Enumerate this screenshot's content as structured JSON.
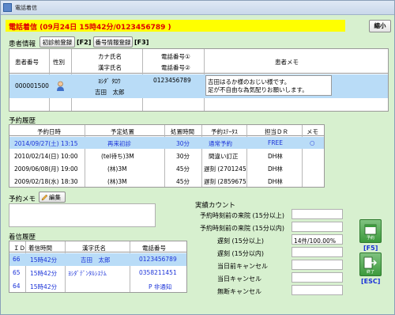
{
  "window": {
    "title": "電話着信",
    "minimize_label": "縮小"
  },
  "banner": "電話着信 (09月24日 15時42分/0123456789 )",
  "patient_section": {
    "title": "患者情報",
    "first_visit_btn": "初診前登録",
    "first_visit_key": "[F2]",
    "number_info_btn": "番号情報登録",
    "number_info_key": "[F3]",
    "headers": {
      "id": "患者番号",
      "sex": "性別",
      "kana": "カナ氏名",
      "kanji": "漢字氏名",
      "tel1": "電話番号①",
      "tel2": "電話番号②",
      "memo": "患者メモ"
    },
    "row": {
      "id": "000001500",
      "kana": "ﾖｼﾀﾞ ﾀﾛｳ",
      "kanji": "吉田　太郎",
      "tel1": "0123456789",
      "memo_line1": "吉田はるか様のおじい様です。",
      "memo_line2": "足が不自由な為気配りお願いします。"
    }
  },
  "reservation_section": {
    "title": "予約履歴",
    "headers": [
      "予約日時",
      "予定処置",
      "処置時間",
      "予約ｽﾃｰﾀｽ",
      "担当ＤＲ",
      "メモ"
    ],
    "rows": [
      {
        "date": "2014/09/27(土) 13:15",
        "treatment": "再来初診",
        "time": "30分",
        "status": "通常予約",
        "dr": "FREE",
        "memo": "○",
        "highlight": true
      },
      {
        "date": "2010/02/14(日) 10:00",
        "treatment": "(tel待ち)3M",
        "time": "30分",
        "status": "間違い訂正",
        "dr": "DH林",
        "memo": "",
        "highlight": false
      },
      {
        "date": "2009/06/08(月) 19:00",
        "treatment": "(林)3M",
        "time": "45分",
        "status": "遅刻 (2701245",
        "dr": "DH林",
        "memo": "",
        "highlight": false
      },
      {
        "date": "2009/02/18(水) 18:30",
        "treatment": "(林)3M",
        "time": "45分",
        "status": "遅刻 (2859675",
        "dr": "DH林",
        "memo": "",
        "highlight": false
      }
    ]
  },
  "reservation_memo": {
    "title": "予約メモ",
    "edit_btn": "編集"
  },
  "count_section": {
    "title": "実績カウント",
    "rows": [
      {
        "label": "予約時刻前の来院 (15分以上)",
        "value": ""
      },
      {
        "label": "予約時刻前の来院 (15分以内)",
        "value": ""
      },
      {
        "label": "遅刻 (15分以上)",
        "value": "14件/100.00%"
      },
      {
        "label": "遅刻 (15分以内)",
        "value": ""
      },
      {
        "label": "当日前キャンセル",
        "value": ""
      },
      {
        "label": "当日キャンセル",
        "value": ""
      },
      {
        "label": "無断キャンセル",
        "value": ""
      }
    ]
  },
  "call_history": {
    "title": "着信履歴",
    "headers": [
      "ＩＤ",
      "着信時間",
      "漢字氏名",
      "電話番号"
    ],
    "rows": [
      {
        "id": "66",
        "time": "15時42分",
        "name": "吉田　太郎",
        "tel": "0123456789",
        "highlight": true
      },
      {
        "id": "65",
        "time": "15時42分",
        "name": "ﾖｼﾀﾞﾃﾞﾝﾀﾙｼｽﾃﾑ",
        "tel": "0358211451",
        "highlight": false
      },
      {
        "id": "64",
        "time": "15時42分",
        "name": "",
        "tel": "P 非通知",
        "highlight": false
      }
    ]
  },
  "side_buttons": {
    "reserve_key": "[F5]",
    "close_key": "[ESC]",
    "reserve_label": "予約",
    "close_label": "終了"
  },
  "colors": {
    "accent_blue": "#1a32d8",
    "banner_bg": "#ffff00",
    "banner_text": "#e00000",
    "row_highlight": "#b9dcf7",
    "panel_green": "#d7f0cf"
  }
}
